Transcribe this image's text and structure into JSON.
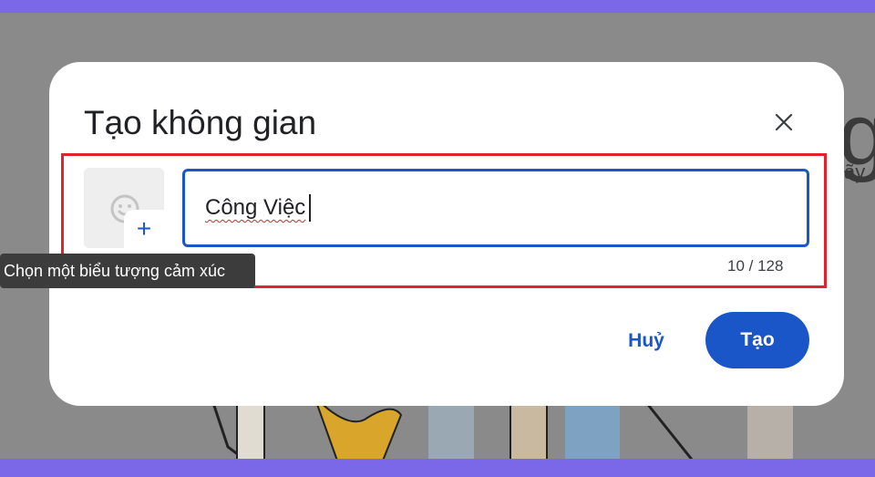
{
  "dialog": {
    "title": "Tạo không gian",
    "close_icon": "close-icon",
    "emoji_picker": {
      "icon": "smiley-face-icon",
      "add_icon": "plus-icon",
      "add_glyph": "+"
    },
    "name_input": {
      "value": "Công Việc"
    },
    "char_count": "10 / 128",
    "cancel_label": "Huỷ",
    "create_label": "Tạo"
  },
  "tooltip": {
    "text": "Chọn một biểu tượng cảm xúc"
  },
  "background": {
    "partial_heading": "g",
    "partial_subtext": "ãy"
  },
  "colors": {
    "frame": "#7b68e8",
    "accent": "#1a56c8",
    "highlight": "#e0242b",
    "overlay": "#8a8a8a"
  }
}
